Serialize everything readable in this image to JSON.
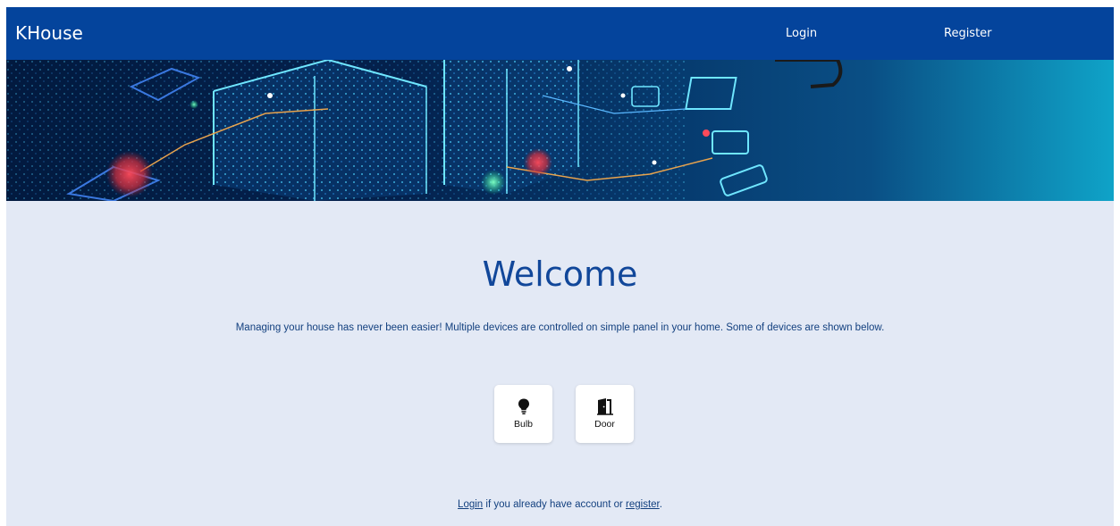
{
  "navbar": {
    "brand": "KHouse",
    "login_label": "Login",
    "register_label": "Register",
    "color": "#04449c"
  },
  "hero": {
    "description_icon": "smart-home-circuit-banner"
  },
  "main": {
    "title": "Welcome",
    "intro": "Managing your house has never been easier! Multiple devices are controlled on simple panel in your home. Some of devices are shown below.",
    "devices": [
      {
        "label": "Bulb",
        "icon": "bulb-icon"
      },
      {
        "label": "Door",
        "icon": "door-icon"
      }
    ]
  },
  "footer": {
    "login_link": "Login",
    "middle_text": " if you already have account or ",
    "register_link": "register",
    "end_text": "."
  },
  "colors": {
    "page_background": "#e3e9f5",
    "accent_text": "#11479a"
  }
}
